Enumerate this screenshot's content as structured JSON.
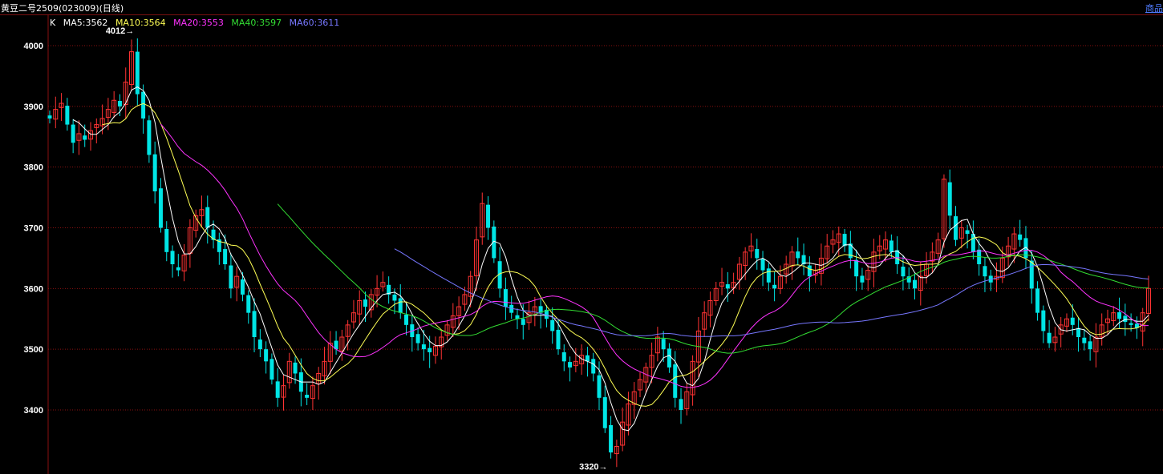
{
  "header": {
    "title": "黄豆二号2509(023009)(日线)",
    "right_link": "商品"
  },
  "legend": {
    "k_label": "K",
    "items": [
      {
        "label": "MA5:3562",
        "color": "#ffffff"
      },
      {
        "label": "MA10:3564",
        "color": "#ffff55"
      },
      {
        "label": "MA20:3553",
        "color": "#ff33ff"
      },
      {
        "label": "MA40:3597",
        "color": "#33dd33"
      },
      {
        "label": "MA60:3611",
        "color": "#7777ff"
      }
    ]
  },
  "colors": {
    "up": "#ff3333",
    "down": "#00e5e5",
    "grid": "#8a1010",
    "axis_text": "#ffffff"
  },
  "chart_data": {
    "type": "candlestick",
    "ylim": [
      3300,
      4060
    ],
    "y_ticks": [
      3400,
      3500,
      3600,
      3700,
      3800,
      3900,
      4000
    ],
    "annotations": [
      {
        "text": "4012→",
        "value": 4012
      },
      {
        "text": "3320→",
        "value": 3320
      }
    ],
    "closes": [
      3880,
      3895,
      3905,
      3870,
      3840,
      3855,
      3845,
      3860,
      3870,
      3880,
      3895,
      3910,
      3900,
      3940,
      3990,
      3920,
      3880,
      3820,
      3760,
      3700,
      3660,
      3640,
      3630,
      3655,
      3700,
      3720,
      3730,
      3700,
      3680,
      3660,
      3640,
      3600,
      3620,
      3590,
      3560,
      3520,
      3500,
      3480,
      3450,
      3420,
      3440,
      3480,
      3460,
      3430,
      3420,
      3440,
      3460,
      3480,
      3510,
      3500,
      3520,
      3540,
      3560,
      3580,
      3570,
      3590,
      3600,
      3610,
      3590,
      3580,
      3560,
      3540,
      3520,
      3510,
      3500,
      3495,
      3505,
      3520,
      3540,
      3555,
      3570,
      3590,
      3620,
      3680,
      3740,
      3700,
      3650,
      3600,
      3570,
      3560,
      3550,
      3540,
      3560,
      3570,
      3560,
      3550,
      3530,
      3500,
      3480,
      3470,
      3480,
      3490,
      3480,
      3460,
      3420,
      3370,
      3330,
      3340,
      3380,
      3410,
      3430,
      3450,
      3470,
      3490,
      3520,
      3500,
      3470,
      3420,
      3400,
      3430,
      3480,
      3530,
      3560,
      3580,
      3600,
      3610,
      3600,
      3610,
      3640,
      3660,
      3670,
      3650,
      3630,
      3610,
      3600,
      3620,
      3640,
      3660,
      3650,
      3640,
      3620,
      3630,
      3650,
      3670,
      3680,
      3690,
      3670,
      3650,
      3620,
      3610,
      3630,
      3660,
      3670,
      3680,
      3660,
      3640,
      3620,
      3610,
      3600,
      3620,
      3640,
      3660,
      3680,
      3780,
      3720,
      3680,
      3700,
      3690,
      3660,
      3640,
      3620,
      3610,
      3620,
      3650,
      3670,
      3690,
      3680,
      3650,
      3600,
      3560,
      3530,
      3510,
      3520,
      3540,
      3550,
      3540,
      3520,
      3510,
      3500,
      3520,
      3540,
      3550,
      3560,
      3550,
      3545,
      3540,
      3535,
      3560,
      3600
    ],
    "high": 4012,
    "low": 3320
  }
}
